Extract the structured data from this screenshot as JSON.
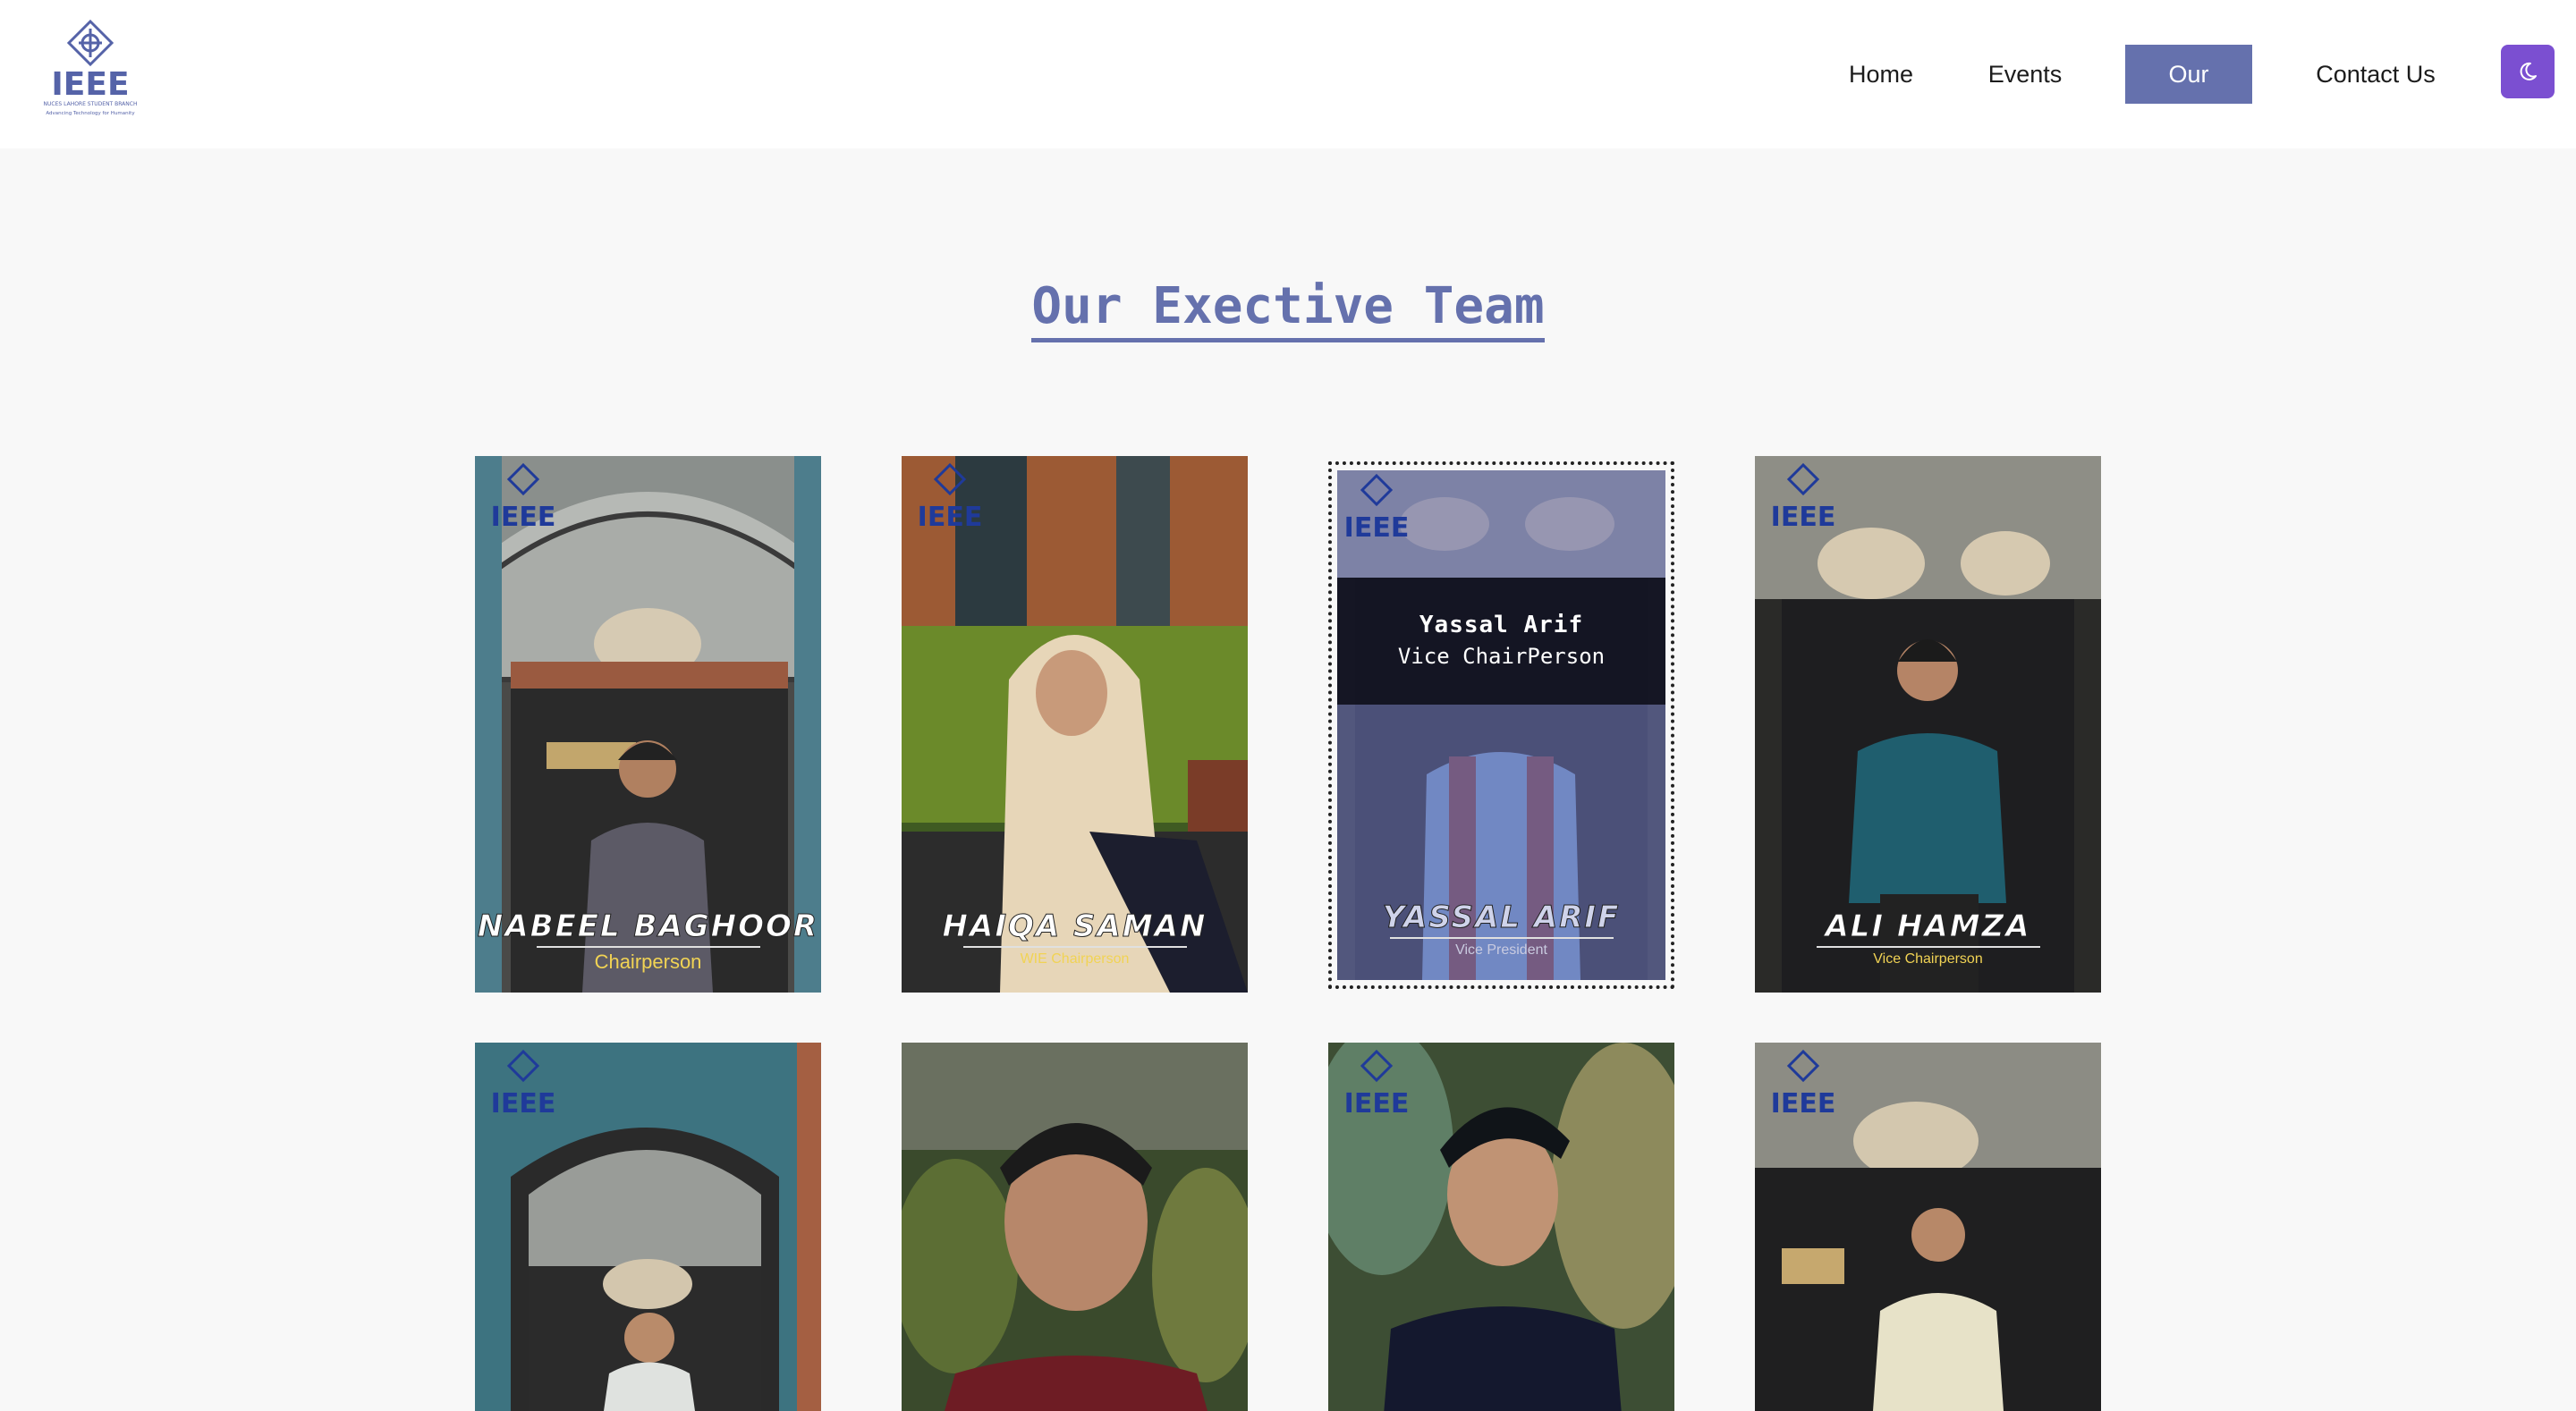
{
  "header": {
    "logo_text": "IEEE",
    "logo_subtext": "NUCES LAHORE STUDENT BRANCH",
    "logo_tagline": "Advancing Technology for Humanity",
    "nav": [
      {
        "label": "Home",
        "active": false
      },
      {
        "label": "Events",
        "active": false
      },
      {
        "label": "Our Team",
        "active": true
      },
      {
        "label": "Contact Us",
        "active": false
      }
    ],
    "theme_toggle_icon": "moon-icon"
  },
  "section_title": "Our Exective Team",
  "colors": {
    "accent": "#6571ad",
    "theme_button": "#7b4fd1",
    "role_text": "#f1d354",
    "page_bg": "#f8f8f8"
  },
  "members": [
    {
      "name": "NABEEL BAGHOOR",
      "role": "Chairperson"
    },
    {
      "name": "HAIQA SAMAN",
      "role": "WIE Chairperson"
    },
    {
      "name": "YASSAL ARIF",
      "role": "Vice President",
      "hover_name": "Yassal Arif",
      "hover_role": "Vice ChairPerson"
    },
    {
      "name": "ALI HAMZA",
      "role": "Vice Chairperson"
    },
    {
      "name": "",
      "role": ""
    },
    {
      "name": "",
      "role": ""
    },
    {
      "name": "",
      "role": ""
    },
    {
      "name": "",
      "role": ""
    }
  ]
}
